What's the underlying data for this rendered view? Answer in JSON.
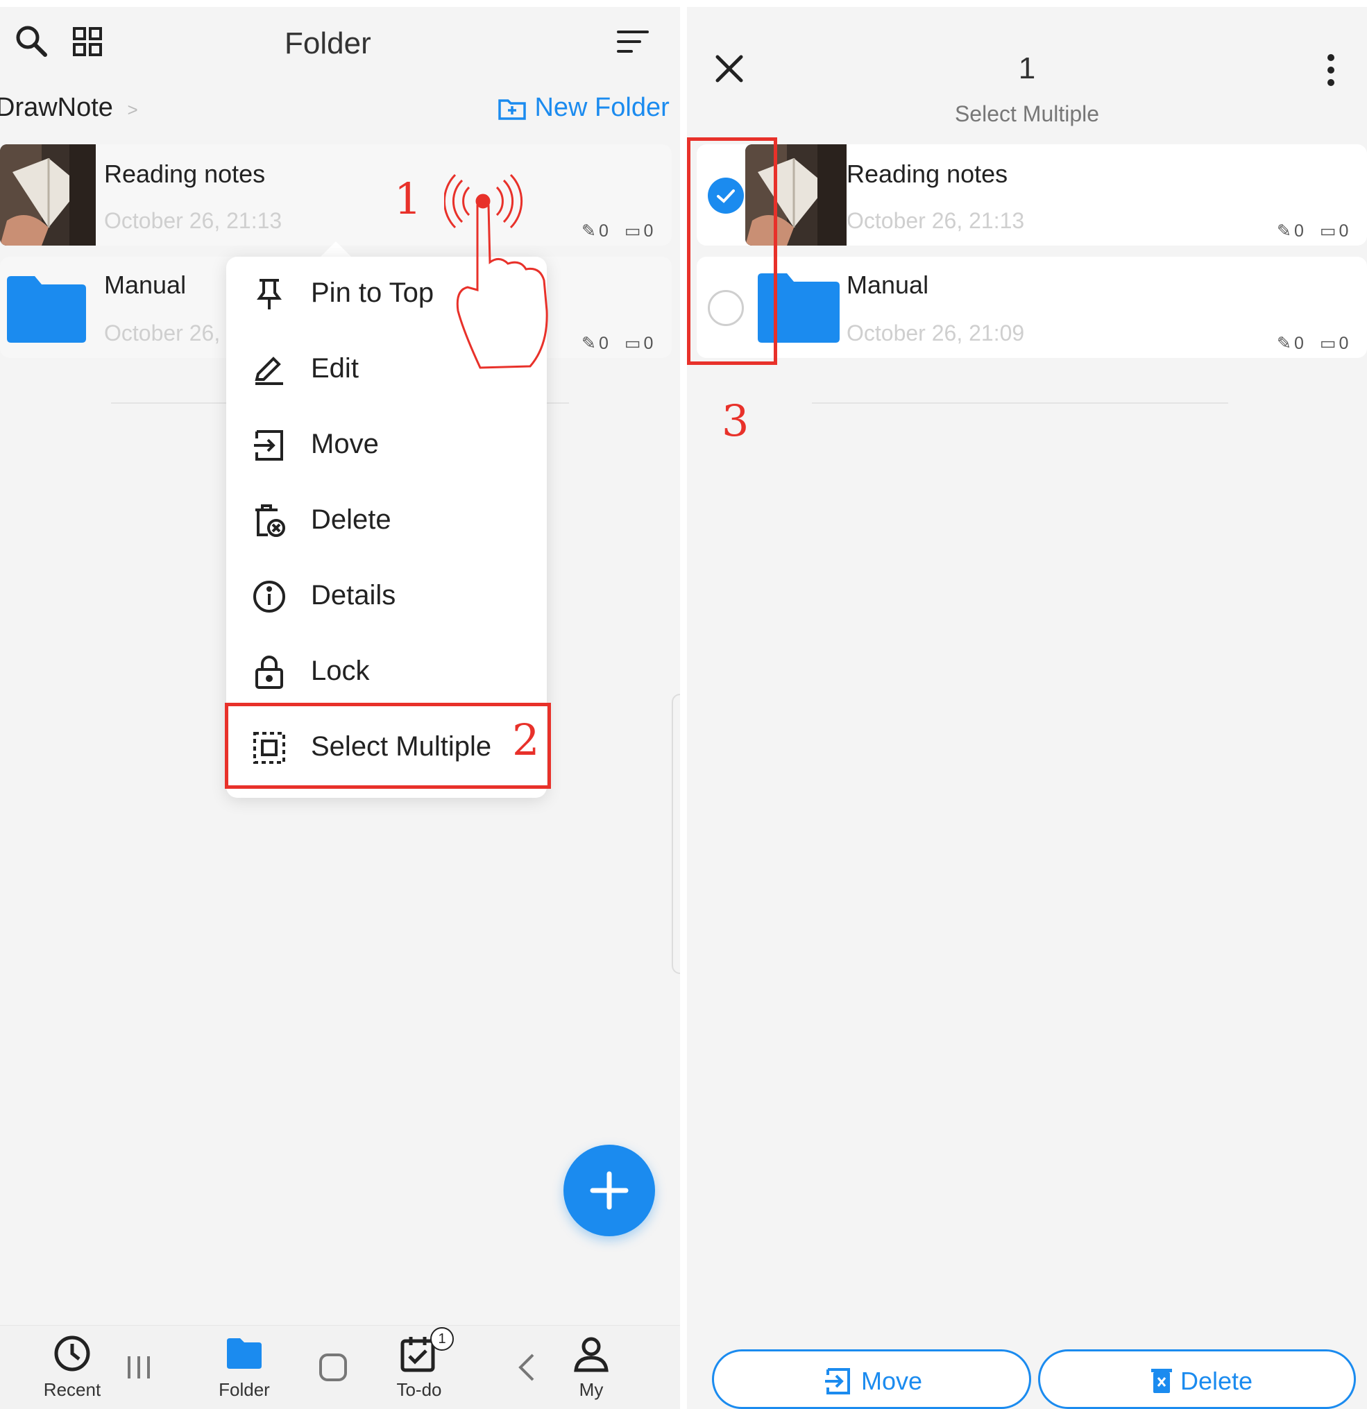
{
  "left": {
    "header": {
      "title": "Folder",
      "icons": [
        "search-icon",
        "grid-icon",
        "sort-icon"
      ]
    },
    "breadcrumb": {
      "root": "DrawNote",
      "separator": ">",
      "new_folder": "New Folder"
    },
    "items": [
      {
        "name": "Reading notes",
        "date": "October 26, 21:13",
        "notes": "0",
        "folders": "0"
      },
      {
        "name": "Manual",
        "date": "October 26,",
        "notes": "0",
        "folders": "0"
      }
    ],
    "context_menu": [
      {
        "label": "Pin to Top",
        "icon": "pin-icon"
      },
      {
        "label": "Edit",
        "icon": "edit-icon"
      },
      {
        "label": "Move",
        "icon": "move-icon"
      },
      {
        "label": "Delete",
        "icon": "delete-icon"
      },
      {
        "label": "Details",
        "icon": "info-icon"
      },
      {
        "label": "Lock",
        "icon": "lock-icon"
      },
      {
        "label": "Select Multiple",
        "icon": "select-multiple-icon"
      }
    ],
    "annotations": {
      "step1": "1",
      "step2": "2"
    },
    "nav": [
      {
        "label": "Recent",
        "icon": "clock-icon",
        "active": false
      },
      {
        "label": "Folder",
        "icon": "folder-icon",
        "active": true
      },
      {
        "label": "To-do",
        "icon": "todo-icon",
        "active": false,
        "badge": "1"
      },
      {
        "label": "My",
        "icon": "person-icon",
        "active": false
      }
    ]
  },
  "right": {
    "header": {
      "count": "1",
      "subtitle": "Select Multiple",
      "icons": [
        "close-icon",
        "more-vert-icon"
      ]
    },
    "items": [
      {
        "name": "Reading notes",
        "date": "October 26, 21:13",
        "notes": "0",
        "folders": "0",
        "selected": true
      },
      {
        "name": "Manual",
        "date": "October 26, 21:09",
        "notes": "0",
        "folders": "0",
        "selected": false
      }
    ],
    "annotations": {
      "step3": "3"
    },
    "actions": {
      "move": "Move",
      "delete": "Delete"
    }
  },
  "colors": {
    "accent": "#1b8bef",
    "annotation": "#e8312a",
    "background": "#f4f4f4"
  }
}
